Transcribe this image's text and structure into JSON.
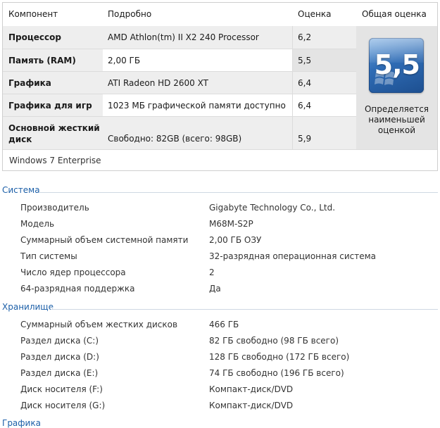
{
  "table": {
    "headers": {
      "component": "Компонент",
      "details": "Подробно",
      "score": "Оценка",
      "overall": "Общая оценка"
    },
    "rows": [
      {
        "component": "Процессор",
        "details": "AMD Athlon(tm) II X2 240 Processor",
        "score": "6,2"
      },
      {
        "component": "Память (RAM)",
        "details": "2,00 ГБ",
        "score": "5,5"
      },
      {
        "component": "Графика",
        "details": "ATI Radeon HD 2600 XT",
        "score": "6,4"
      },
      {
        "component": "Графика для игр",
        "details": "1023 МБ графической памяти доступно",
        "score": "6,4"
      },
      {
        "component_line1": "Основной жесткий",
        "component_line2": "диск",
        "details": "Свободно: 82GB (всего: 98GB)",
        "score": "5,9"
      }
    ],
    "overall": {
      "value": "5,5",
      "note_line1": "Определяется",
      "note_line2": "наименьшей",
      "note_line3": "оценкой"
    },
    "os": "Windows 7 Enterprise"
  },
  "system": {
    "title": "Система",
    "items": [
      {
        "label": "Производитель",
        "value": "Gigabyte Technology Co., Ltd."
      },
      {
        "label": "Модель",
        "value": "M68M-S2P"
      },
      {
        "label": "Суммарный объем системной памяти",
        "value": "2,00 ГБ ОЗУ"
      },
      {
        "label": "Тип системы",
        "value": "32-разрядная операционная система"
      },
      {
        "label": "Число ядер процессора",
        "value": "2"
      },
      {
        "label": "64-разрядная поддержка",
        "value": "Да"
      }
    ]
  },
  "storage": {
    "title": "Хранилище",
    "items": [
      {
        "label": "Суммарный объем жестких дисков",
        "value": "466 ГБ"
      },
      {
        "label": "Раздел диска (C:)",
        "value": "82 ГБ свободно (98 ГБ всего)"
      },
      {
        "label": "Раздел диска (D:)",
        "value": "128 ГБ свободно (172 ГБ всего)"
      },
      {
        "label": "Раздел диска (E:)",
        "value": "74 ГБ свободно (196 ГБ всего)"
      },
      {
        "label": "Диск носителя (F:)",
        "value": "Компакт-диск/DVD"
      },
      {
        "label": "Диск носителя (G:)",
        "value": "Компакт-диск/DVD"
      }
    ]
  },
  "graphics": {
    "title": "Графика"
  }
}
